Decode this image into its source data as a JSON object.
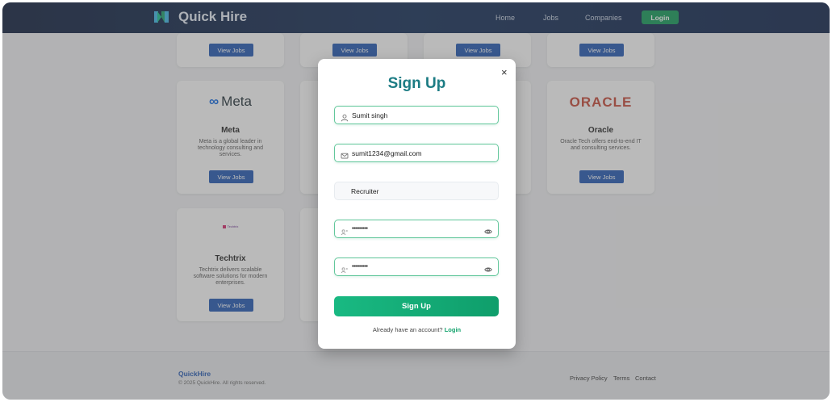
{
  "nav": {
    "brand": "Quick Hire",
    "links": [
      "Home",
      "Jobs",
      "Companies"
    ],
    "login": "Login"
  },
  "companies": [
    {
      "name": "Meta",
      "logo_text": "Meta",
      "desc": "Meta is a global leader in technology consulting and services.",
      "button": "View Jobs"
    },
    {
      "name": "Oracle",
      "logo_text": "ORACLE",
      "desc": "Oracle Tech offers end-to-end IT and consulting services.",
      "button": "View Jobs"
    },
    {
      "name": "Techtrix",
      "logo_text": "Techtrix",
      "desc": "Techtrix delivers scalable software solutions for modern enterprises.",
      "button": "View Jobs"
    }
  ],
  "top_row_button": "View Jobs",
  "footer": {
    "brand": "QuickHire",
    "copyright": "© 2025 QuickHire. All rights reserved.",
    "links": [
      "Privacy Policy",
      "Terms",
      "Contact"
    ]
  },
  "modal": {
    "title": "Sign Up",
    "close_glyph": "×",
    "fields": {
      "name": "Sumit singh",
      "email": "sumit1234@gmail.com",
      "role": "Recruiter",
      "password": "••••••••••",
      "confirm_password": "••••••••••"
    },
    "submit": "Sign Up",
    "switch_text": "Already have an account?",
    "switch_link": "Login"
  },
  "colors": {
    "nav_bg": "#0f2a55",
    "accent_green": "#10a46d",
    "title_teal": "#1c7c84",
    "button_blue": "#1f56b3"
  },
  "icons": [
    "logo-icon",
    "user-icon",
    "mail-icon",
    "lock-icon",
    "eye-icon",
    "close-icon"
  ]
}
